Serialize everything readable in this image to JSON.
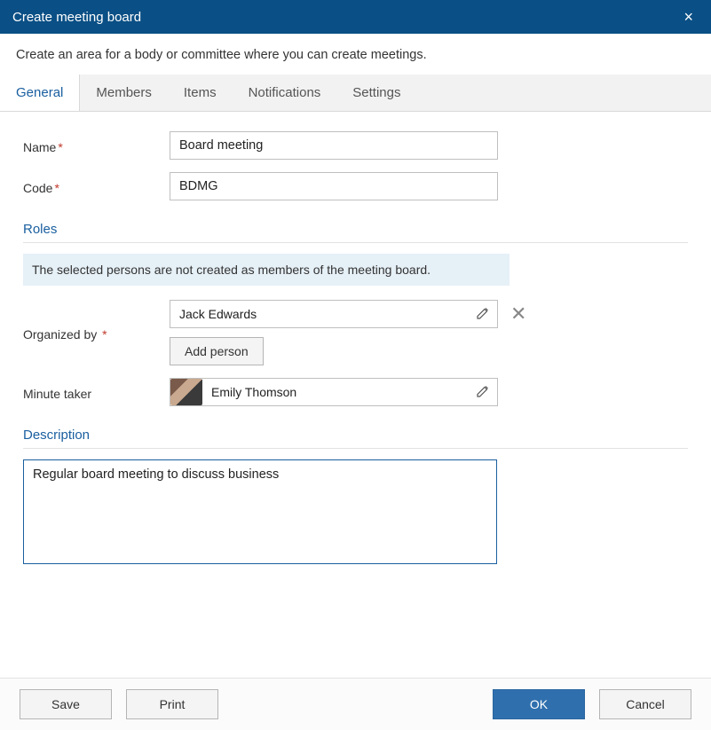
{
  "header": {
    "title": "Create meeting board",
    "close_icon": "×"
  },
  "subtitle": "Create an area for a body or committee where you can create meetings.",
  "tabs": [
    {
      "label": "General",
      "active": true
    },
    {
      "label": "Members",
      "active": false
    },
    {
      "label": "Items",
      "active": false
    },
    {
      "label": "Notifications",
      "active": false
    },
    {
      "label": "Settings",
      "active": false
    }
  ],
  "fields": {
    "name_label": "Name",
    "name_value": "Board meeting",
    "code_label": "Code",
    "code_value": "BDMG"
  },
  "roles": {
    "section_label": "Roles",
    "info_text": "The selected persons are not created as members of the meeting board.",
    "organized_by_label": "Organized by",
    "organized_by_value": "Jack Edwards",
    "add_person_label": "Add person",
    "minute_taker_label": "Minute taker",
    "minute_taker_value": "Emily Thomson"
  },
  "description": {
    "section_label": "Description",
    "value": "Regular board meeting to discuss business"
  },
  "footer": {
    "save": "Save",
    "print": "Print",
    "ok": "OK",
    "cancel": "Cancel"
  }
}
